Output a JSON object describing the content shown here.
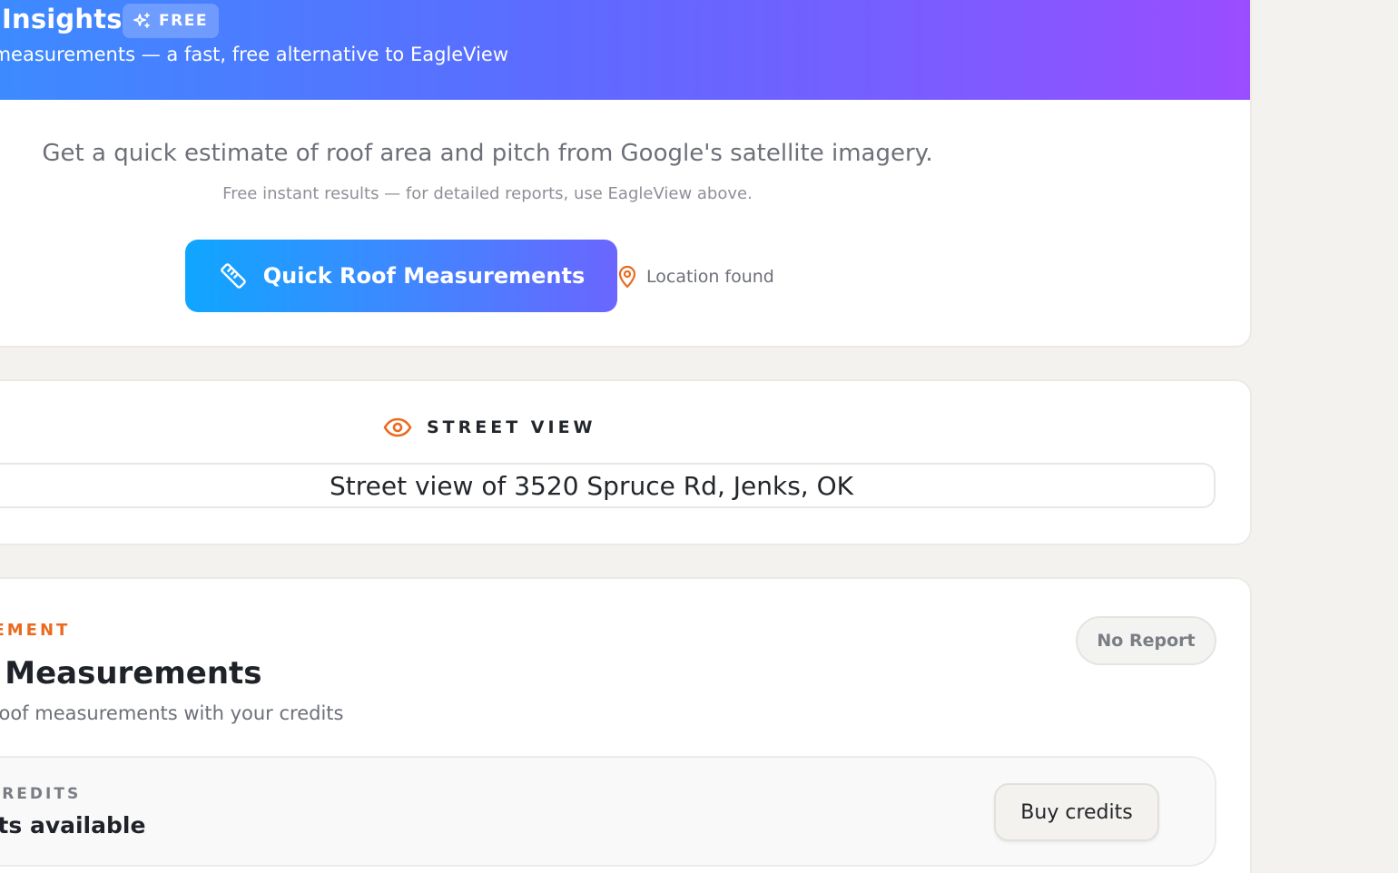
{
  "header": {
    "title": "Insights",
    "badge": "FREE",
    "subtitle": "e measurements — a fast, free alternative to EagleView"
  },
  "quick_estimate": {
    "intro": "Get a quick estimate of roof area and pitch from Google's satellite imagery.",
    "note": "Free instant results — for detailed reports, use EagleView above.",
    "button_label": "Quick Roof Measurements",
    "location_status": "Location found"
  },
  "street_view": {
    "heading": "STREET VIEW",
    "image_alt": "Street view of 3520 Spruce Rd, Jenks, OK"
  },
  "measurement": {
    "eyebrow": "SUREMENT",
    "title": "w Measurements",
    "description": "sional roof measurements with your credits",
    "status_badge": "No Report",
    "credits_label": "NT CREDITS",
    "credits_value": "edits available",
    "buy_button": "Buy credits"
  },
  "colors": {
    "accent_orange": "#ea6a1e",
    "banner_start": "#3b8cff",
    "banner_end": "#9a4dff",
    "button_start": "#0fa6ff",
    "button_end": "#6a66ff"
  },
  "icons": {
    "badge": "sparkles-icon",
    "button": "ruler-icon",
    "location": "map-pin-icon",
    "street_view": "eye-icon"
  }
}
